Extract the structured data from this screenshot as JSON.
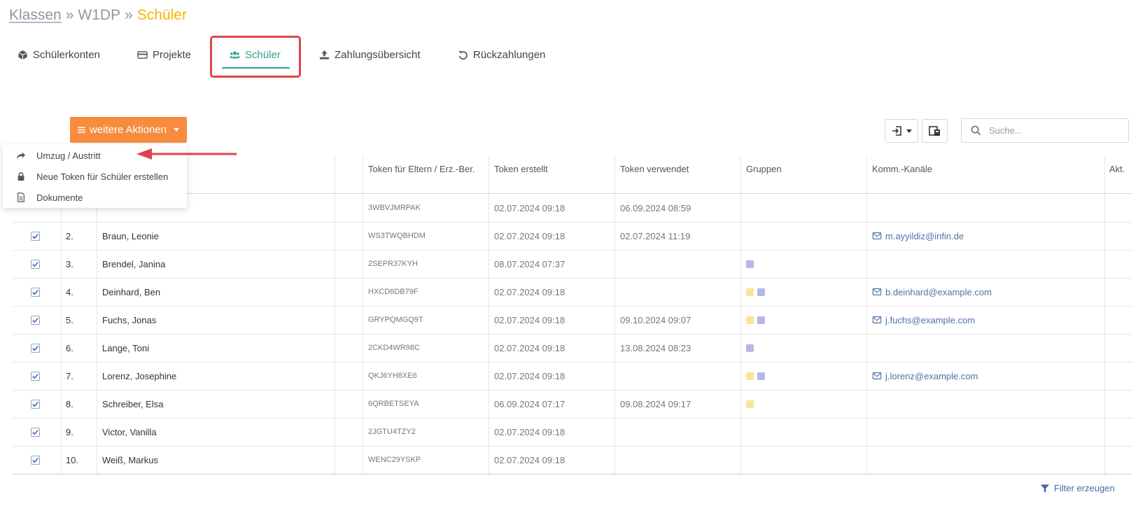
{
  "breadcrumb": {
    "root": "Klassen",
    "sep1": "»",
    "class_name": "W1DP",
    "sep2": "»",
    "current": "Schüler"
  },
  "tabs": [
    {
      "label": "Schülerkonten",
      "icon": "cube-icon"
    },
    {
      "label": "Projekte",
      "icon": "credit-card-icon"
    },
    {
      "label": "Schüler",
      "icon": "users-icon",
      "active": true
    },
    {
      "label": "Zahlungsübersicht",
      "icon": "upload-icon"
    },
    {
      "label": "Rückzahlungen",
      "icon": "undo-icon"
    }
  ],
  "actions": {
    "button_label": "weitere Aktionen",
    "menu": [
      {
        "label": "Umzug / Austritt",
        "icon": "share-icon"
      },
      {
        "label": "Neue Token für Schüler erstellen",
        "icon": "lock-icon"
      },
      {
        "label": "Dokumente",
        "icon": "document-icon"
      }
    ]
  },
  "search": {
    "placeholder": "Suche..."
  },
  "table": {
    "headers": {
      "token": "Token für Eltern / Erz.-Ber.",
      "created": "Token erstellt",
      "used": "Token verwendet",
      "groups": "Gruppen",
      "channels": "Komm.-Kanäle",
      "actions": "Akt."
    },
    "rows": [
      {
        "num": "",
        "name": "",
        "token": "3WBVJMRPAK",
        "created": "02.07.2024 09:18",
        "used": "06.09.2024 08:59",
        "groups": [],
        "email": ""
      },
      {
        "num": "2.",
        "name": "Braun, Leonie",
        "token": "WS3TWQBHDM",
        "created": "02.07.2024 09:18",
        "used": "02.07.2024 11:19",
        "groups": [],
        "email": "m.ayyildiz@infin.de"
      },
      {
        "num": "3.",
        "name": "Brendel, Janina",
        "token": "2SEPR37KYH",
        "created": "08.07.2024 07:37",
        "used": "",
        "groups": [
          "purple"
        ],
        "email": ""
      },
      {
        "num": "4.",
        "name": "Deinhard, Ben",
        "token": "HXCD6DB79F",
        "created": "02.07.2024 09:18",
        "used": "",
        "groups": [
          "yellow",
          "purple"
        ],
        "email": "b.deinhard@example.com"
      },
      {
        "num": "5.",
        "name": "Fuchs, Jonas",
        "token": "GRYPQMGQ9T",
        "created": "02.07.2024 09:18",
        "used": "09.10.2024 09:07",
        "groups": [
          "yellow",
          "purple"
        ],
        "email": "j.fuchs@example.com"
      },
      {
        "num": "6.",
        "name": "Lange, Toni",
        "token": "2CKD4WR98C",
        "created": "02.07.2024 09:18",
        "used": "13.08.2024 08:23",
        "groups": [
          "purple"
        ],
        "email": ""
      },
      {
        "num": "7.",
        "name": "Lorenz, Josephine",
        "token": "QKJ6YH8XE6",
        "created": "02.07.2024 09:18",
        "used": "",
        "groups": [
          "yellow",
          "purple"
        ],
        "email": "j.lorenz@example.com"
      },
      {
        "num": "8.",
        "name": "Schreiber, Elsa",
        "token": "6QRBETSEYA",
        "created": "06.09.2024 07:17",
        "used": "09.08.2024 09:17",
        "groups": [
          "yellow"
        ],
        "email": ""
      },
      {
        "num": "9.",
        "name": "Victor, Vanilla",
        "token": "2JGTU4TZY2",
        "created": "02.07.2024 09:18",
        "used": "",
        "groups": [],
        "email": ""
      },
      {
        "num": "10.",
        "name": "Weiß, Markus",
        "token": "WENC29YSKP",
        "created": "02.07.2024 09:18",
        "used": "",
        "groups": [],
        "email": ""
      }
    ]
  },
  "group_colors": {
    "yellow": "#fbe49a",
    "purple": "#b4b8e4"
  },
  "colors": {
    "accent": "#2ea395",
    "action_button": "#f68c3d",
    "highlight": "#e0434b",
    "breadcrumb_current": "#f4b400",
    "link": "#4e72a8"
  },
  "filter": {
    "label": "Filter erzeugen"
  }
}
